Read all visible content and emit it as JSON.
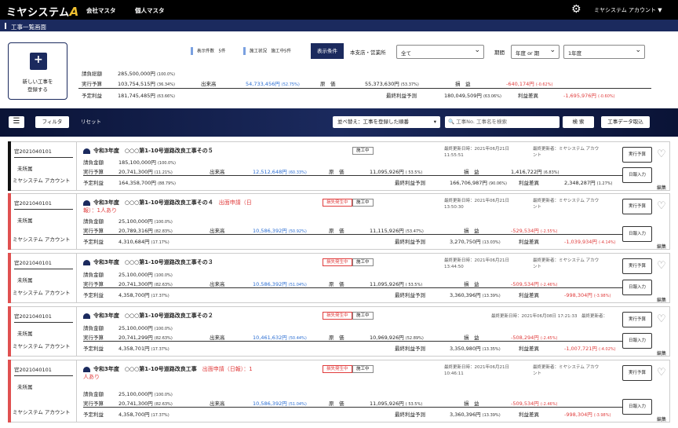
{
  "header": {
    "logo": "ミヤシステム",
    "logo_mark": "A",
    "nav": [
      "会社マスタ",
      "個人マスタ"
    ],
    "account": "ミヤシステム アカウント ▼"
  },
  "page_title": "工事一覧画面",
  "new_button": {
    "line1": "新しい工事を",
    "line2": "登録する"
  },
  "legend": {
    "count_label": "表示件数",
    "count": "5件",
    "status_label": "施工状況",
    "status": "施工中5件"
  },
  "summary": {
    "contract_label": "請負総額",
    "contract": "285,500,000円",
    "contract_pct": "(100.0%)",
    "exec_label": "実行予算",
    "exec": "103,754,515円",
    "exec_pct": "(36.34%)",
    "prod_label": "出来高",
    "prod": "54,733,456円",
    "prod_pct": "(52.75%)",
    "cost_label": "原　価",
    "cost": "55,373,630円",
    "cost_pct": "(53.37%)",
    "profit_label": "損　益",
    "profit": "-640,174円",
    "profit_pct": "(-0.62%)",
    "plan_label": "予定利益",
    "plan": "181,745,485円",
    "plan_pct": "(63.66%)",
    "final_label": "最終利益予測",
    "final": "180,049,509円",
    "final_pct": "(63.06%)",
    "diff_label": "利益差異",
    "diff": "-1,695,976円",
    "diff_pct": "(-0.60%)"
  },
  "filters": {
    "display_cond": "表示条件",
    "branch_label": "本支店・営業所",
    "branch": "全て",
    "period_label": "期間",
    "period_type": "年度 or 期",
    "period_value": "1年度"
  },
  "toolbar": {
    "filter": "フィルタ",
    "reset": "リセット",
    "sort": "並べ替え：工事を登録した順番",
    "search_placeholder": "工事No. 工事名を検索",
    "search": "検 索",
    "import": "工事データ取込"
  },
  "labels": {
    "contract": "請負金額",
    "exec": "実行予算",
    "plan": "予定利益",
    "prod": "出来高",
    "cost": "原　価",
    "final": "最終利益予測",
    "profit": "損　益",
    "diff": "利益差異",
    "budget_btn": "実行予算",
    "daily_btn": "日報入力",
    "edit": "編集",
    "working": "施工中",
    "loss": "損失発生中",
    "updated": "最終更新日時：",
    "updater": "最終更新者："
  },
  "cards": [
    {
      "code": "官2021040101",
      "kind": "未所属",
      "owner": "ミヤシステム アカウント",
      "title": "令和3年度　○○○第1-10号道路改良工事その５",
      "alert": "",
      "loss": false,
      "date1": "2021年06月21日",
      "date2": "11:55:51",
      "updater1": "ミヤシステム アカウ",
      "updater2": "ント",
      "contract": "185,100,000円",
      "contract_pct": "(100.0%)",
      "exec": "20,741,300円",
      "exec_pct": "(11.21%)",
      "prod": "12,512,648円",
      "prod_pct": "(60.33%)",
      "cost": "11,095,926円",
      "cost_pct": "( 53.5%)",
      "profit": "1,416,722円",
      "profit_pct": "(6.83%)",
      "plan": "164,358,700円",
      "plan_pct": "(88.79%)",
      "final": "166,706,987円",
      "final_pct": "(90.06%)",
      "diff": "2,348,287円",
      "diff_pct": "(1.27%)",
      "diff_red": false,
      "profit_red": false
    },
    {
      "code": "官2021040101",
      "kind": "未所属",
      "owner": "ミヤシステム アカウント",
      "title": "令和3年度　○○○第1-10号道路改良工事その４",
      "alert": "出面申請（日",
      "alert2": "報）：1人あり",
      "loss": true,
      "date1": "2021年06月21日",
      "date2": "13:50:30",
      "updater1": "ミヤシステム アカウ",
      "updater2": "ント",
      "contract": "25,100,000円",
      "contract_pct": "(100.0%)",
      "exec": "20,789,316円",
      "exec_pct": "(82.83%)",
      "prod": "10,586,392円",
      "prod_pct": "(50.92%)",
      "cost": "11,115,926円",
      "cost_pct": "(53.47%)",
      "profit": "-529,534円",
      "profit_pct": "(-2.55%)",
      "plan": "4,310,684円",
      "plan_pct": "(17.17%)",
      "final": "3,270,750円",
      "final_pct": "(13.03%)",
      "diff": "-1,039,934円",
      "diff_pct": "(-4.14%)",
      "diff_red": true,
      "profit_red": true
    },
    {
      "code": "官2021040101",
      "kind": "未所属",
      "owner": "ミヤシステム アカウント",
      "title": "令和3年度　○○○第1-10号道路改良工事その３",
      "alert": "",
      "loss": true,
      "date1": "2021年06月21日",
      "date2": "13:44:50",
      "updater1": "ミヤシステム アカウ",
      "updater2": "ント",
      "contract": "25,100,000円",
      "contract_pct": "(100.0%)",
      "exec": "20,741,300円",
      "exec_pct": "(82.63%)",
      "prod": "10,586,392円",
      "prod_pct": "(51.04%)",
      "cost": "11,095,926円",
      "cost_pct": "( 53.5%)",
      "profit": "-509,534円",
      "profit_pct": "(-2.46%)",
      "plan": "4,358,700円",
      "plan_pct": "(17.37%)",
      "final": "3,360,396円",
      "final_pct": "(13.39%)",
      "diff": "-998,304円",
      "diff_pct": "(-3.98%)",
      "diff_red": true,
      "profit_red": true
    },
    {
      "code": "官2021040101",
      "kind": "未所属",
      "owner": "ミヤシステム アカウント",
      "title": "令和3年度　○○○第1-10号道路改良工事その２",
      "alert": "",
      "loss": true,
      "date1": "2021年06月08日 17:21:33",
      "date2": "",
      "updater1": "",
      "updater2": "",
      "contract": "25,100,000円",
      "contract_pct": "(100.0%)",
      "exec": "20,741,299円",
      "exec_pct": "(82.63%)",
      "prod": "10,461,632円",
      "prod_pct": "(50.44%)",
      "cost": "10,969,926円",
      "cost_pct": "(52.89%)",
      "profit": "-508,294円",
      "profit_pct": "(-2.45%)",
      "plan": "4,358,701円",
      "plan_pct": "(17.37%)",
      "final": "3,350,980円",
      "final_pct": "(13.35%)",
      "diff": "-1,007,721円",
      "diff_pct": "(-4.02%)",
      "diff_red": true,
      "profit_red": true
    },
    {
      "code": "官2021040101",
      "kind": "未所属",
      "owner": "ミヤシステム アカウント",
      "title": "令和3年度　○○○第1-10号道路改良工事",
      "alert": "出面申請（日報）：1",
      "alert2": "人あり",
      "loss": true,
      "date1": "2021年06月21日",
      "date2": "10:46:11",
      "updater1": "ミヤシステム アカウ",
      "updater2": "ント",
      "contract": "25,100,000円",
      "contract_pct": "(100.0%)",
      "exec": "20,741,300円",
      "exec_pct": "(82.63%)",
      "prod": "10,586,392円",
      "prod_pct": "(51.04%)",
      "cost": "11,095,926円",
      "cost_pct": "( 53.5%)",
      "profit": "-509,534円",
      "profit_pct": "(-2.46%)",
      "plan": "4,358,700円",
      "plan_pct": "(17.37%)",
      "final": "3,360,396円",
      "final_pct": "(13.39%)",
      "diff": "-998,304円",
      "diff_pct": "(-3.98%)",
      "diff_red": true,
      "profit_red": true
    }
  ],
  "colors": {
    "navy": "#1b2a5e",
    "alert": "#e03c3c",
    "stripe_black": "#111111",
    "stripe_red": "#e05050"
  }
}
